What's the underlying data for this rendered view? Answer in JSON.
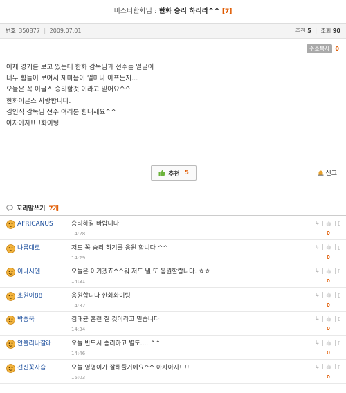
{
  "header": {
    "board": "미스터한화님",
    "separator": ":",
    "subject": "한화 승리 하리라^^",
    "comment_count": "[7]"
  },
  "meta": {
    "number_label": "번호",
    "number": "350877",
    "date": "2009.07.01",
    "recommend_label": "추천",
    "recommend_value": "5",
    "views_label": "조회",
    "views_value": "90"
  },
  "address_copy": {
    "label": "주소복사",
    "count": "0"
  },
  "post": {
    "lines": [
      "어제 경기를 보고 있는데 한화 감독님과 선수들 얼굴이",
      "너무 힘들어 보여서 제마음이 얼마나 아프든지...",
      "오늘은 꼭 이글스 승리할것 이라고 믿어요^^",
      "한화이글스 사랑합니다.",
      "김인식 감독님 선수 여러분 힘내세요^^",
      "아자아자!!!!화이팅"
    ]
  },
  "actions": {
    "recommend_label": "추천",
    "recommend_count": "5",
    "report_label": "신고"
  },
  "comments_section": {
    "title": "꼬리말쓰기",
    "count": "7개"
  },
  "comments": [
    {
      "author": "AFRICANUS",
      "text": "승리하길 바랍니다.",
      "time": "14:28",
      "votes": "0"
    },
    {
      "author": "나름대로",
      "text": "저도 꼭 승리 하기를 응원 합니다 ^^",
      "time": "14:29",
      "votes": "0"
    },
    {
      "author": "이나시엔",
      "text": "오늘은 이기겠죠^^뭐 저도 낼 또 응원할랍니다. ㅎㅎ",
      "time": "14:31",
      "votes": "0"
    },
    {
      "author": "초원이88",
      "text": "응원합니다 한화화이팅",
      "time": "14:32",
      "votes": "0"
    },
    {
      "author": "박종욱",
      "text": "김태균 홈런 칠 것이라고 믿습니다",
      "time": "14:34",
      "votes": "0"
    },
    {
      "author": "안쫄리나잘래",
      "text": "오늘 반드시 승리하고 별도.....^^",
      "time": "14:46",
      "votes": "0"
    },
    {
      "author": "선진꽃사슴",
      "text": "오늘 영명이가 잘해줄거에요^^ 아자아자!!!!",
      "time": "15:03",
      "votes": "0"
    }
  ],
  "colors": {
    "accent": "#e05a00",
    "link": "#1a4d9c"
  }
}
